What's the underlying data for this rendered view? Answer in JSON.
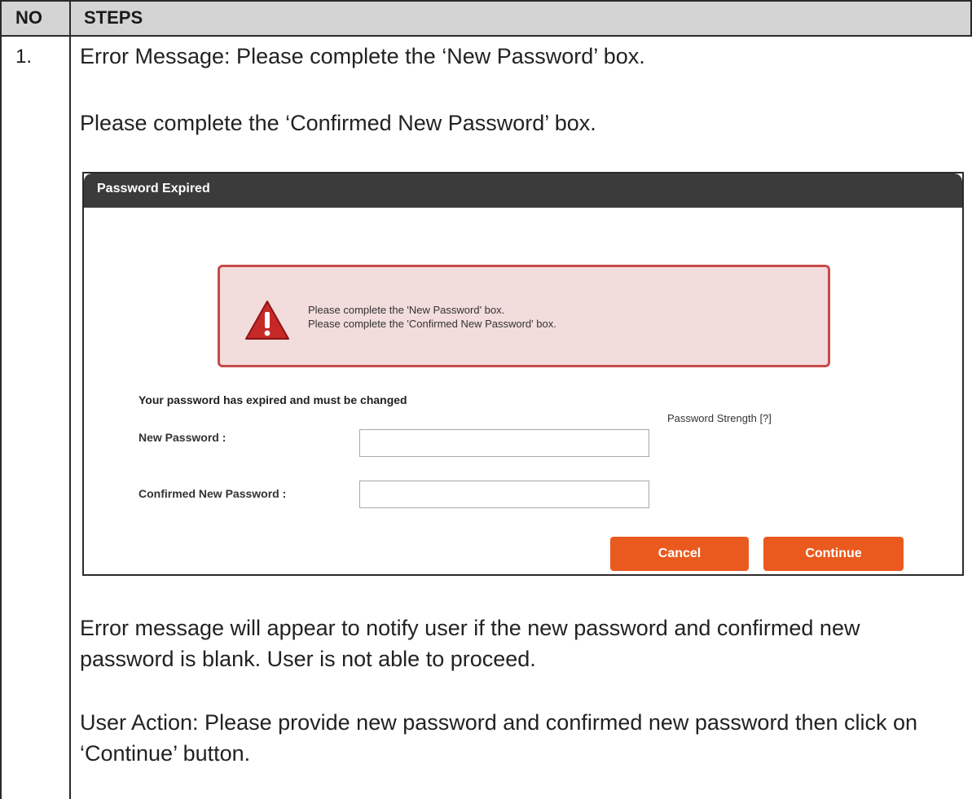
{
  "table": {
    "header_no": "NO",
    "header_steps": "STEPS",
    "row_number": "1."
  },
  "step": {
    "error_line_1": "Error Message: Please complete the ‘New Password’ box.",
    "error_line_2": "Please complete the ‘Confirmed New Password’ box.",
    "description": "Error message will appear to notify user if the new password and confirmed new password is blank. User is not able to proceed.",
    "user_action": "User Action: Please provide new password and confirmed new password then click on ‘Continue’ button."
  },
  "dialog": {
    "title": "Password Expired",
    "error_box": {
      "icon": "warning-icon",
      "messages": [
        "Please complete the 'New Password' box.",
        "Please complete the 'Confirmed New Password' box."
      ]
    },
    "expired_notice": "Your password has expired and must be changed",
    "password_strength_label": "Password Strength [?]",
    "new_password_label": "New Password :",
    "new_password_value": "",
    "confirmed_password_label": "Confirmed New Password :",
    "confirmed_password_value": "",
    "cancel_label": "Cancel",
    "continue_label": "Continue"
  },
  "colors": {
    "title_bar": "#3b3b3b",
    "error_background": "#f2dcdc",
    "error_border": "#c84a4a",
    "button": "#ea5a1f"
  }
}
